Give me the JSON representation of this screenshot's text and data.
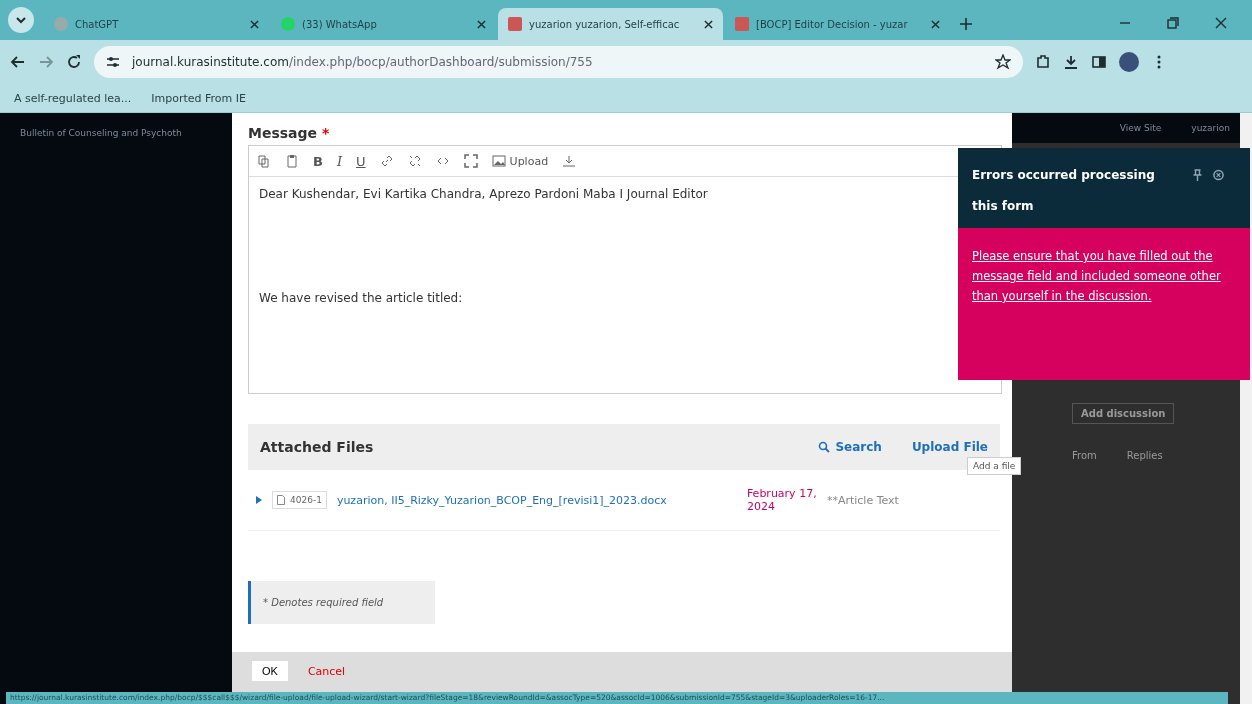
{
  "browser": {
    "tabs": [
      {
        "title": "ChatGPT",
        "selected": false,
        "kind": "chat"
      },
      {
        "title": "(33) WhatsApp",
        "selected": false,
        "kind": "whatsapp"
      },
      {
        "title": "yuzarion yuzarion, Self-efficac",
        "selected": true,
        "kind": "journal"
      },
      {
        "title": "[BOCP] Editor Decision - yuzar",
        "selected": false,
        "kind": "journal"
      }
    ],
    "url_host": "journal.kurasinstitute.com",
    "url_path": "/index.php/bocp/authorDashboard/submission/755",
    "bookmarks": [
      "A self-regulated lea...",
      "Imported From IE"
    ]
  },
  "site": {
    "title": "Bulletin of Counseling and Psychoth",
    "view_site": "View Site",
    "user": "yuzarion",
    "add_discussion": "Add discussion",
    "col_a": "From",
    "col_b": "Replies"
  },
  "modal": {
    "message_label": "Message",
    "required_mark": "*",
    "format_buttons": [
      "B",
      "I",
      "U"
    ],
    "upload_label": "Upload",
    "body_lines": [
      "Dear Kushendar, Evi Kartika Chandra, Aprezo Pardoni Maba I Journal Editor",
      "We have revised the article titled:"
    ],
    "files": {
      "title": "Attached Files",
      "search": "Search",
      "upload": "Upload File",
      "tooltip": "Add a file",
      "rows": [
        {
          "id": "4026-1",
          "name": "yuzarion, II5_Rizky_Yuzarion_BCOP_Eng_[revisi1]_2023.docx",
          "date": "February 17, 2024",
          "type": "**Article Text"
        }
      ]
    },
    "required_note": "* Denotes required field",
    "ok": "OK",
    "cancel": "Cancel"
  },
  "error": {
    "title": "Errors occurred processing this form",
    "message": "Please ensure that you have filled out the message field and included someone other than yourself in the discussion."
  },
  "status_url": "https://journal.kurasinstitute.com/index.php/bocp/$$$call$$$/wizard/file-upload/file-upload-wizard/start-wizard?fileStage=18&reviewRoundId=&assocType=520&assocId=1006&submissionId=755&stageId=3&uploaderRoles=16-17..."
}
